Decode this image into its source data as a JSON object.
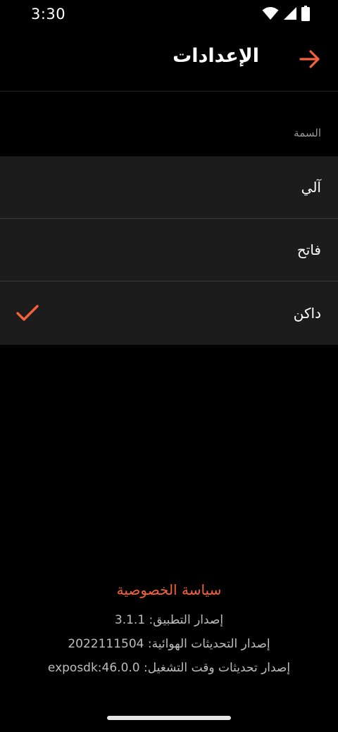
{
  "status_bar": {
    "time": "3:30",
    "icons": [
      "wifi-icon",
      "signal-icon",
      "battery-icon"
    ]
  },
  "header": {
    "title": "الإعدادات",
    "back_icon": "arrow-right-icon"
  },
  "theme_section": {
    "label": "السمة",
    "options": [
      {
        "label": "آلي",
        "selected": false
      },
      {
        "label": "فاتح",
        "selected": false
      },
      {
        "label": "داكن",
        "selected": true
      }
    ]
  },
  "footer": {
    "privacy_link": "سياسة الخصوصية",
    "app_version": "إصدار التطبيق: 3.1.1",
    "ota_version": "إصدار التحديثات الهوائية: 2022111504",
    "runtime_version": "إصدار تحديثات وقت التشغيل: exposdk:46.0.0"
  },
  "colors": {
    "accent": "#f4613a",
    "background": "#000000",
    "row_background": "#1c1c1c"
  }
}
